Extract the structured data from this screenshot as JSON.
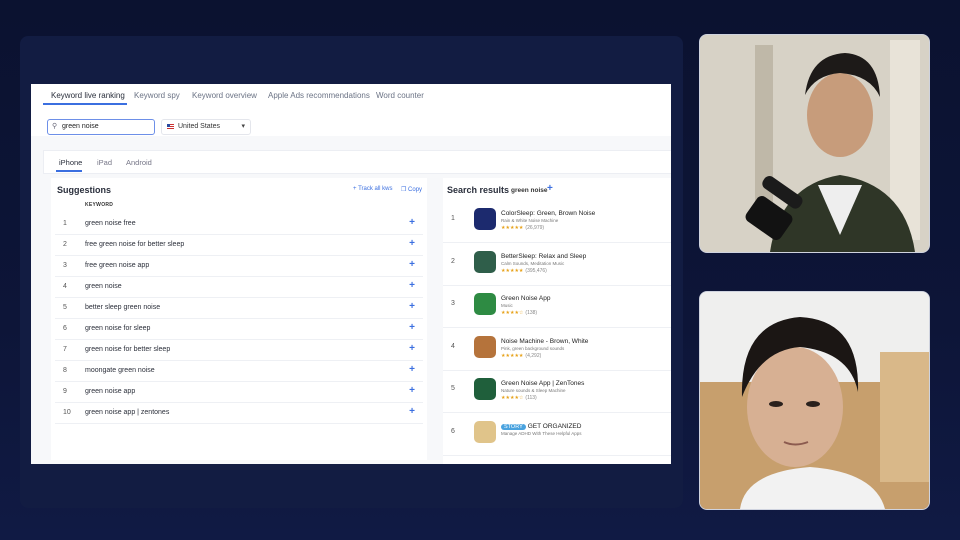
{
  "nav_tabs": [
    "Keyword live ranking",
    "Keyword spy",
    "Keyword overview",
    "Apple Ads recommendations",
    "Word counter"
  ],
  "search": {
    "value": "green noise",
    "icon": "search-icon"
  },
  "country": {
    "label": "United States",
    "flag": "us-flag-icon"
  },
  "device_tabs": [
    "iPhone",
    "iPad",
    "Android"
  ],
  "suggestions": {
    "title": "Suggestions",
    "track_all": "+ Track all kws",
    "copy": "Copy",
    "column_header": "KEYWORD",
    "items": [
      {
        "rank": "1",
        "keyword": "green noise free"
      },
      {
        "rank": "2",
        "keyword": "free green noise for better sleep"
      },
      {
        "rank": "3",
        "keyword": "free green noise app"
      },
      {
        "rank": "4",
        "keyword": "green noise"
      },
      {
        "rank": "5",
        "keyword": "better sleep green noise"
      },
      {
        "rank": "6",
        "keyword": "green noise for sleep"
      },
      {
        "rank": "7",
        "keyword": "green noise for better sleep"
      },
      {
        "rank": "8",
        "keyword": "moongate green noise"
      },
      {
        "rank": "9",
        "keyword": "green noise app"
      },
      {
        "rank": "10",
        "keyword": "green noise app | zentones"
      }
    ]
  },
  "results": {
    "title": "Search results",
    "term": "green noise",
    "apps": [
      {
        "rank": "1",
        "name": "ColorSleep: Green, Brown Noise",
        "subtitle": "Rain & White Noise Machine",
        "stars": "★★★★★",
        "count": "(26,979)",
        "color": "#1c2a6e"
      },
      {
        "rank": "2",
        "name": "BetterSleep: Relax and Sleep",
        "subtitle": "Calm Sounds, Meditation Music",
        "stars": "★★★★★",
        "count": "(395,476)",
        "color": "#2f5e4a"
      },
      {
        "rank": "3",
        "name": "Green Noise App",
        "subtitle": "Music",
        "stars": "★★★★☆",
        "count": "(138)",
        "color": "#2e8b43"
      },
      {
        "rank": "4",
        "name": "Noise Machine - Brown, White",
        "subtitle": "Pink, green background sounds",
        "stars": "★★★★★",
        "count": "(4,292)",
        "color": "#b5733b"
      },
      {
        "rank": "5",
        "name": "Green Noise App | ZenTones",
        "subtitle": "Nature sounds & Sleep Machine",
        "stars": "★★★★☆",
        "count": "(113)",
        "color": "#1f5f3b"
      },
      {
        "rank": "6",
        "badge": "STORY",
        "name": "GET ORGANIZED",
        "subtitle": "Manage ADHD With These Helpful Apps",
        "color": "#e0c48a"
      }
    ]
  }
}
